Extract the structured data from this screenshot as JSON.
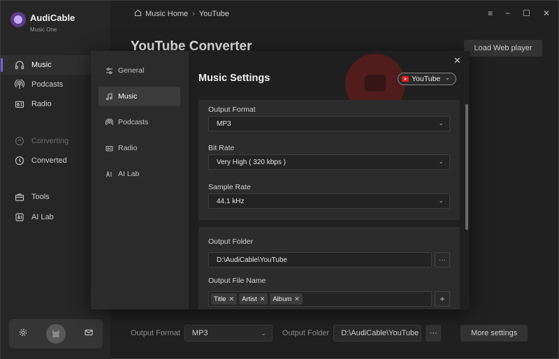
{
  "brand": {
    "name": "AudiCable",
    "subtitle": "Music One"
  },
  "sidebar": {
    "items": [
      {
        "label": "Music",
        "icon": "headphones-icon",
        "state": "active"
      },
      {
        "label": "Podcasts",
        "icon": "podcast-icon",
        "state": "normal"
      },
      {
        "label": "Radio",
        "icon": "radio-icon",
        "state": "normal"
      },
      {
        "label": "Converting",
        "icon": "converting-icon",
        "state": "disabled"
      },
      {
        "label": "Converted",
        "icon": "clock-icon",
        "state": "normal"
      },
      {
        "label": "Tools",
        "icon": "toolbox-icon",
        "state": "normal"
      },
      {
        "label": "AI Lab",
        "icon": "ai-icon",
        "state": "normal"
      }
    ]
  },
  "topbar": {
    "home": "Music Home",
    "current": "YouTube"
  },
  "main": {
    "title": "YouTube Converter",
    "load_button": "Load Web player",
    "bottom": {
      "format_label": "Output Format",
      "format_value": "MP3",
      "folder_label": "Output Folder",
      "folder_value": "D:\\AudiCable\\YouTube",
      "more_settings": "More settings",
      "dots": "···"
    }
  },
  "modal": {
    "nav": [
      {
        "label": "General",
        "icon": "sliders-icon",
        "active": false
      },
      {
        "label": "Music",
        "icon": "music-note-icon",
        "active": true
      },
      {
        "label": "Podcasts",
        "icon": "podcast-icon",
        "active": false
      },
      {
        "label": "Radio",
        "icon": "radio-icon",
        "active": false
      },
      {
        "label": "AI Lab",
        "icon": "ai-icon",
        "active": false
      }
    ],
    "title": "Music Settings",
    "source": "YouTube",
    "close": "✕",
    "fields": {
      "output_format_label": "Output Format",
      "output_format_value": "MP3",
      "bit_rate_label": "Bit Rate",
      "bit_rate_value": "Very High ( 320 kbps )",
      "sample_rate_label": "Sample Rate",
      "sample_rate_value": "44.1 kHz",
      "output_folder_label": "Output Folder",
      "output_folder_value": "D:\\AudiCable\\YouTube",
      "output_file_name_label": "Output File Name",
      "file_name_tags": [
        "Title",
        "Artist",
        "Album"
      ],
      "dots": "···",
      "plus": "+"
    }
  },
  "colors": {
    "accent": "#7a63d6",
    "youtube_red": "#e62117",
    "background": "#202020"
  }
}
